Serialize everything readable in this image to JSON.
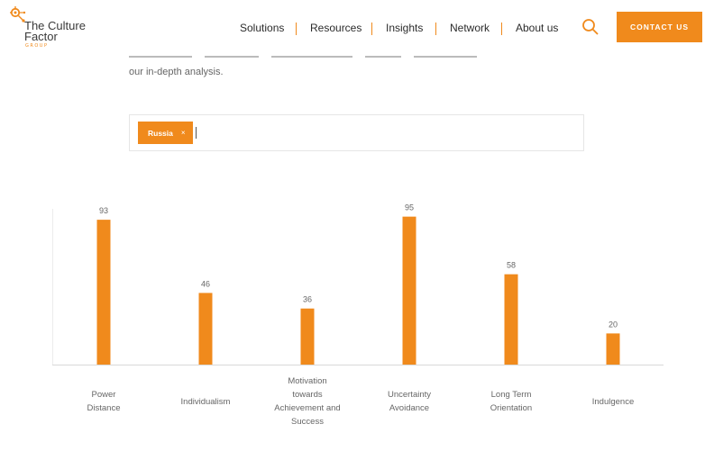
{
  "header": {
    "logo": {
      "line1": "The Culture",
      "line2": "Factor",
      "sub": "GROUP"
    },
    "nav": [
      {
        "label": "Solutions"
      },
      {
        "label": "Resources"
      },
      {
        "label": "Insights"
      },
      {
        "label": "Network"
      },
      {
        "label": "About us"
      }
    ],
    "contact_label": "CONTACT US",
    "accent_color": "#f08a1c"
  },
  "intro": {
    "text": "our in-depth analysis."
  },
  "filter": {
    "tags": [
      {
        "label": "Russia",
        "remove": "×"
      }
    ]
  },
  "chart_data": {
    "type": "bar",
    "categories": [
      "Power Distance",
      "Individualism",
      "Motivation towards Achievement and Success",
      "Uncertainty Avoidance",
      "Long Term Orientation",
      "Indulgence"
    ],
    "series": [
      {
        "values": [
          93,
          46,
          36,
          95,
          58,
          20
        ],
        "color": "#f08a1c"
      }
    ],
    "ylim": [
      0,
      100
    ],
    "grid": false,
    "title": "",
    "xlabel": "",
    "ylabel": ""
  }
}
